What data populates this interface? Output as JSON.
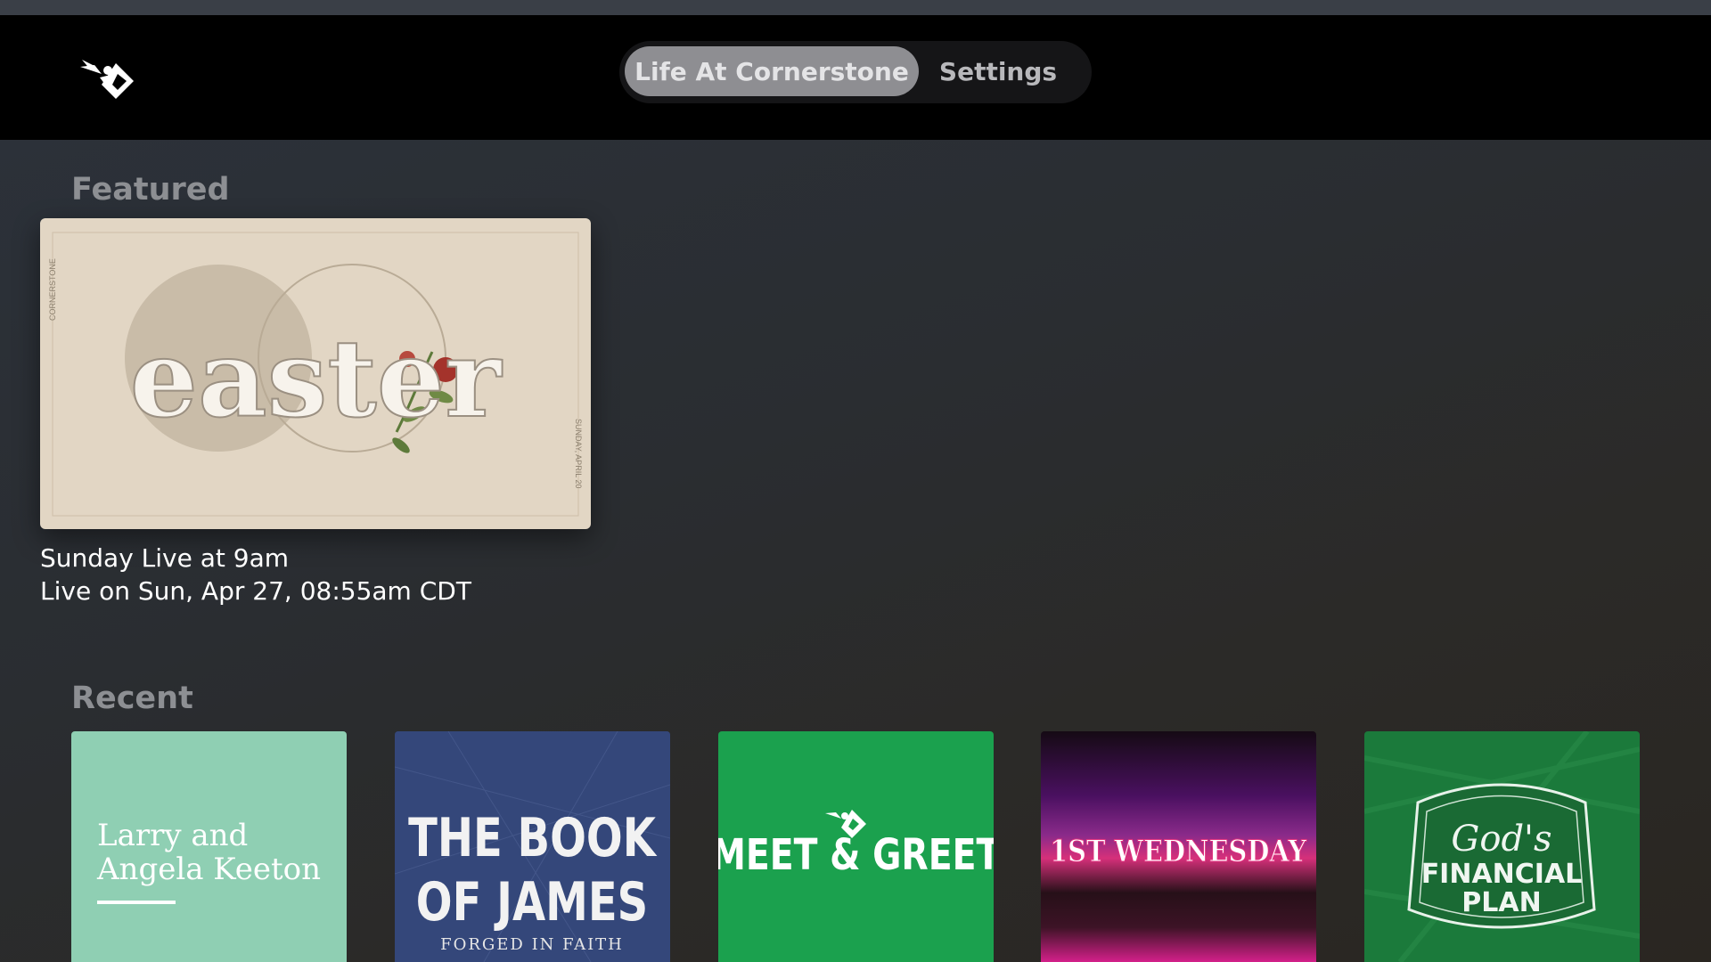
{
  "nav": {
    "tabs": [
      {
        "label": "Life At Cornerstone",
        "active": true
      },
      {
        "label": "Settings",
        "active": false
      }
    ]
  },
  "featured": {
    "section_title": "Featured",
    "item": {
      "art_title": "easter",
      "side_text_left": "CORNERSTONE",
      "side_text_right": "SUNDAY, APRIL 20",
      "title": "Sunday Live at 9am",
      "subtitle": "Live on Sun, Apr 27, 08:55am CDT"
    }
  },
  "recent": {
    "section_title": "Recent",
    "items": [
      {
        "line1": "Larry and",
        "line2": "Angela Keeton",
        "bg": "#8fcfb3"
      },
      {
        "line1": "THE BOOK",
        "line2": "OF JAMES",
        "line3": "FORGED IN FAITH",
        "bg": "#34477a"
      },
      {
        "line1": "MEET & GREET",
        "bg": "#1ba14e"
      },
      {
        "line1": "1ST WEDNESDAY",
        "bg": "#1a0f1d"
      },
      {
        "line1": "God's",
        "line2": "FINANCIAL",
        "line3": "PLAN",
        "bg": "#1b7a3b"
      }
    ]
  },
  "colors": {
    "topbar": "#000000",
    "tab_active": "#8e8e92",
    "section_title": "#8d8f93"
  }
}
